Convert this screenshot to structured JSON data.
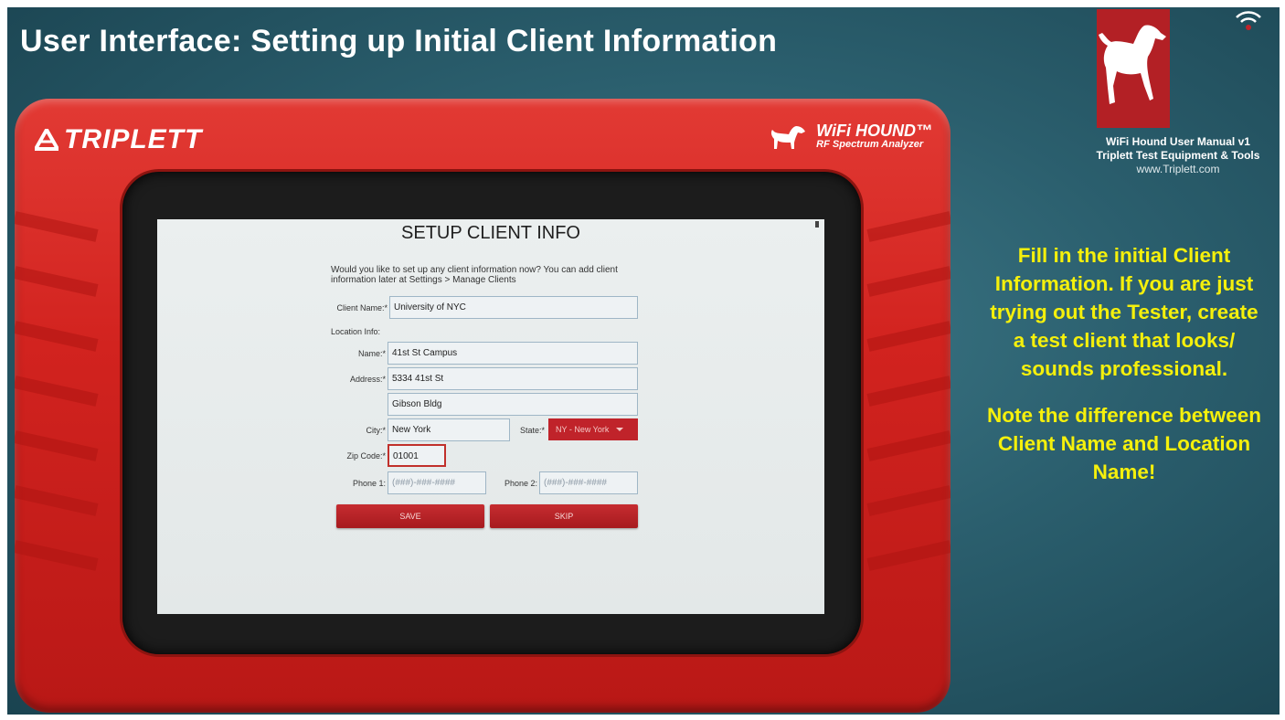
{
  "slide": {
    "title": "User Interface: Setting up Initial Client Information",
    "manual_line1": "WiFi Hound User Manual v1",
    "manual_line2": "Triplett Test Equipment & Tools",
    "manual_url": "www.Triplett.com",
    "note_paragraph1": "Fill in the initial Client Information. If you are just trying out the Tester, create a test client that looks/ sounds professional.",
    "note_paragraph2": "Note the difference between Client Name and Location Name!",
    "colors": {
      "background": "#2b5f6e",
      "note_text": "#f5f00c",
      "device_red": "#d2231f"
    }
  },
  "device": {
    "brand": "TRIPLETT",
    "product_name": "WiFi HOUND™",
    "product_sub": "RF Spectrum Analyzer",
    "icons": [
      "triplett-logo-icon",
      "hound-icon",
      "wifi-signal-icon"
    ]
  },
  "screen": {
    "title": "SETUP CLIENT INFO",
    "prompt": "Would you like to set up any client information now? You can add client information later at Settings > Manage Clients",
    "client_name_label": "Client Name:*",
    "client_name_value": "University of NYC",
    "location_info_label": "Location Info:",
    "name_label": "Name:*",
    "name_value": "41st St Campus",
    "address_label": "Address:*",
    "address_line1": "5334 41st St",
    "address_line2": "Gibson Bldg",
    "city_label": "City:*",
    "city_value": "New York",
    "state_label": "State:*",
    "state_value": "NY - New York",
    "zip_label": "Zip Code:*",
    "zip_value": "01001",
    "phone1_label": "Phone 1:",
    "phone1_placeholder": "(###)-###-####",
    "phone2_label": "Phone 2:",
    "phone2_placeholder": "(###)-###-####",
    "save_label": "SAVE",
    "skip_label": "SKIP"
  }
}
